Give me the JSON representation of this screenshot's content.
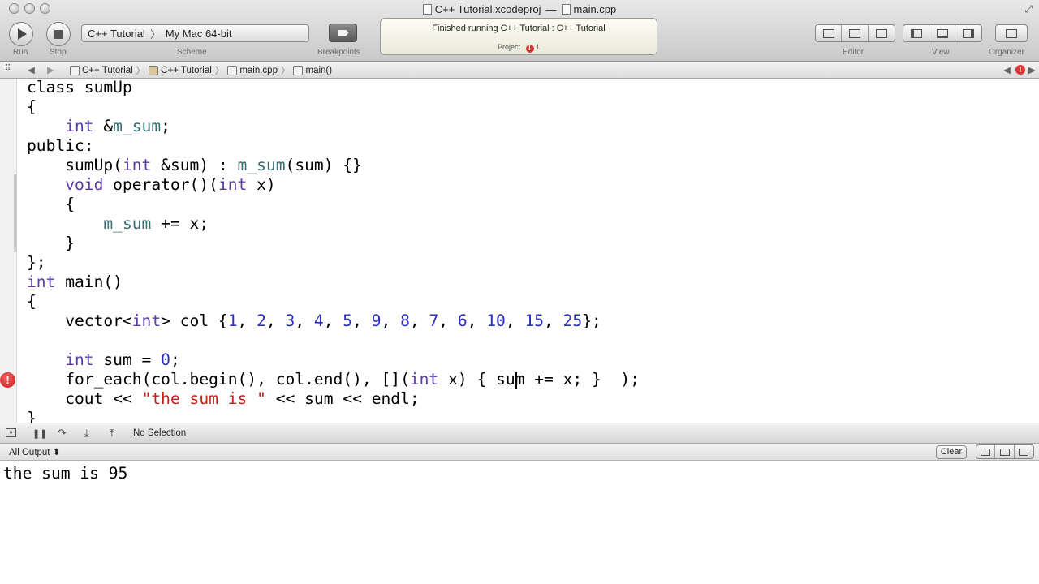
{
  "window": {
    "title_project": "C++ Tutorial.xcodeproj",
    "title_separator": "—",
    "title_file": "main.cpp"
  },
  "toolbar": {
    "run_label": "Run",
    "stop_label": "Stop",
    "scheme_target": "C++ Tutorial",
    "scheme_separator": "〉",
    "scheme_destination": "My Mac 64-bit",
    "scheme_label": "Scheme",
    "breakpoints_label": "Breakpoints",
    "activity_message": "Finished running C++ Tutorial : C++ Tutorial",
    "activity_project": "Project",
    "activity_error_count": "1",
    "editor_label": "Editor",
    "view_label": "View",
    "organizer_label": "Organizer"
  },
  "jumpbar": {
    "crumbs": [
      "C++ Tutorial",
      "C++ Tutorial",
      "main.cpp",
      "main()"
    ],
    "separator": "〉"
  },
  "code": {
    "lines": [
      "class sumUp",
      "{",
      "    int &m_sum;",
      "public:",
      "    sumUp(int &sum) : m_sum(sum) {}",
      "    void operator()(int x)",
      "    {",
      "        m_sum += x;",
      "    }",
      "};",
      "int main()",
      "{",
      "    vector<int> col {1, 2, 3, 4, 5, 9, 8, 7, 6, 10, 15, 25};",
      "",
      "    int sum = 0;",
      "    for_each(col.begin(), col.end(), [](int x) { sum += x; }  );",
      "    cout << \"the sum is \" << sum << endl;",
      "}"
    ],
    "error_line": 16,
    "error_glyph": "!"
  },
  "debug": {
    "selection_text": "No Selection"
  },
  "console": {
    "filter_label": "All Output ⬍",
    "clear_label": "Clear",
    "output": "the sum is 95"
  },
  "colors": {
    "keyword": "#000000",
    "type": "#5a3aa8",
    "number": "#2a2ec2",
    "string": "#c4211c",
    "member": "#3a6e72",
    "error": "#d33333"
  }
}
